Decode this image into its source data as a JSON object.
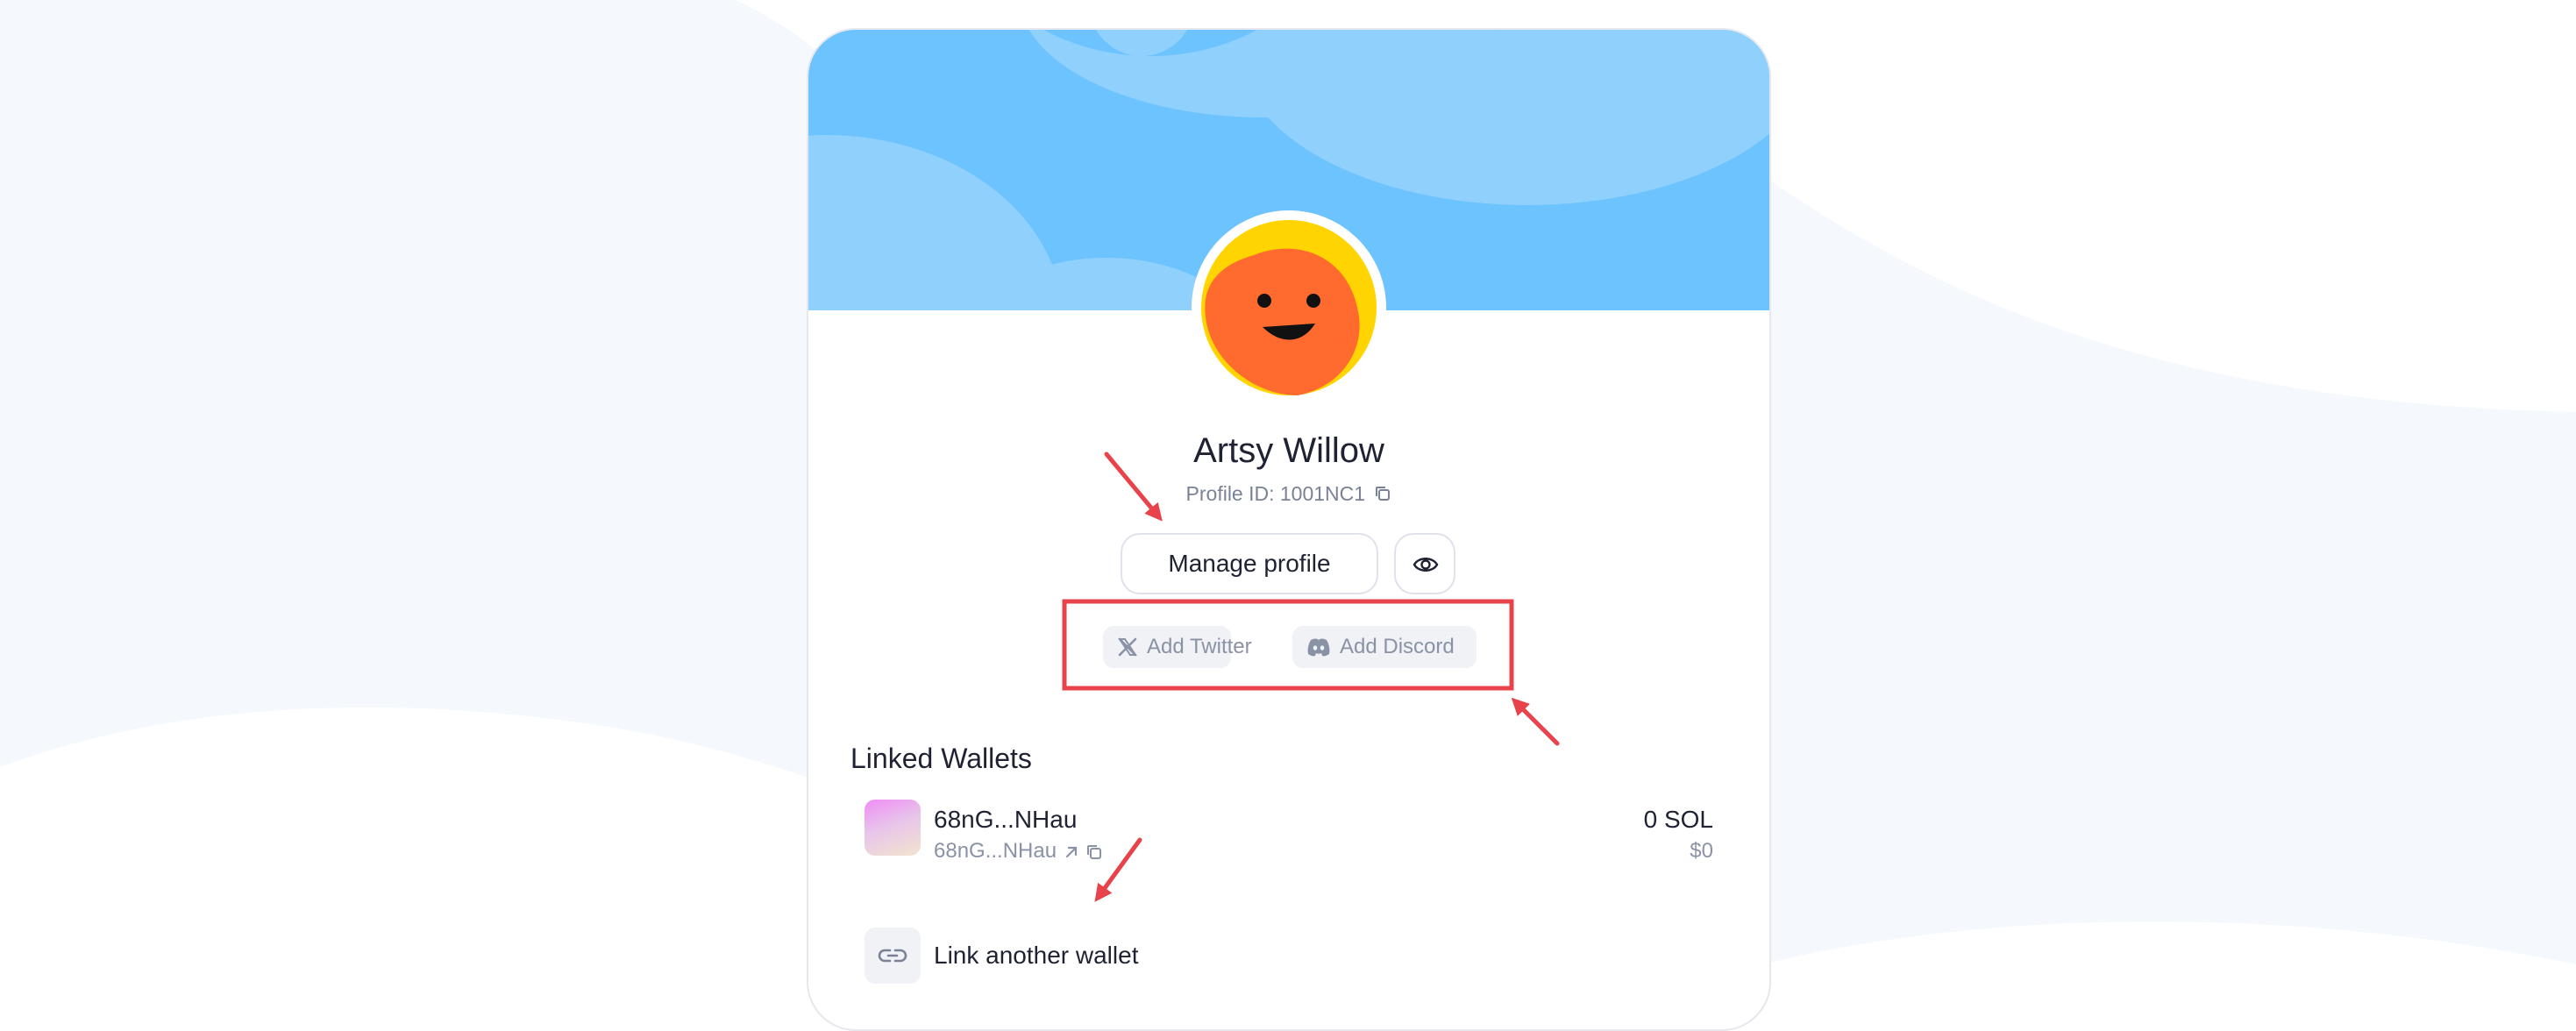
{
  "profile": {
    "name": "Artsy Willow",
    "id_label": "Profile ID: 1001NC1"
  },
  "actions": {
    "manage_label": "Manage profile"
  },
  "socials": {
    "twitter_label": "Add Twitter",
    "discord_label": "Add Discord"
  },
  "wallets": {
    "section_title": "Linked Wallets",
    "items": [
      {
        "name": "68nG...NHau",
        "address": "68nG...NHau",
        "balance": "0 SOL",
        "usd": "$0"
      }
    ],
    "link_label": "Link another wallet"
  },
  "colors": {
    "banner": "#6cc3fd",
    "cloud": "#8fd0fd",
    "annotation": "#e8434a",
    "avatar_face": "#ff6b2f",
    "avatar_hair": "#ffd400"
  },
  "icons": {
    "copy": "copy-icon",
    "eye": "eye-icon",
    "twitter": "x-logo-icon",
    "discord": "discord-icon",
    "external": "arrow-up-right-icon",
    "link": "link-icon"
  }
}
